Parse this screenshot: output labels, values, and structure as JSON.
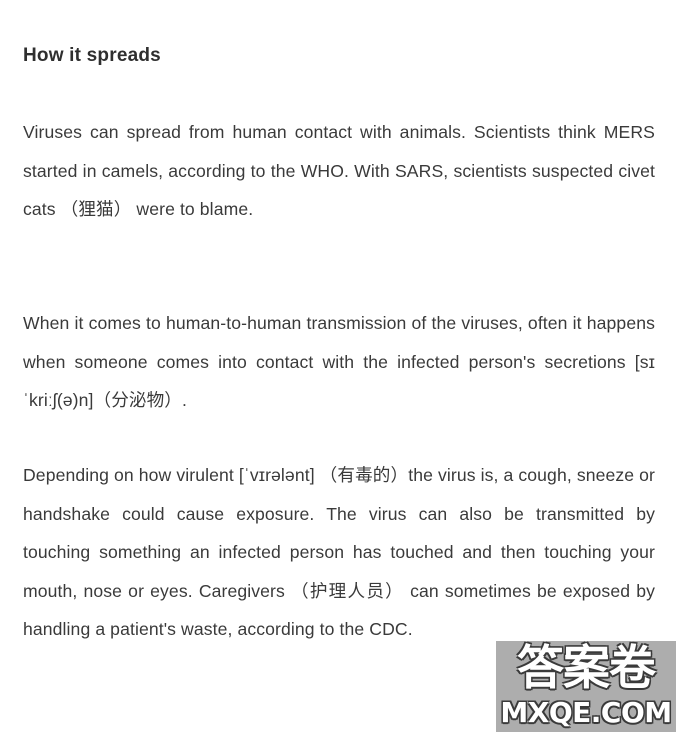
{
  "document": {
    "heading": "How it spreads",
    "paragraphs": [
      "Viruses can spread from human contact with animals. Scientists think MERS started in camels, according to the WHO. With SARS, scientists suspected civet cats （狸猫） were to blame.",
      "When it comes to human-to-human transmission of the viruses, often it happens when someone comes into contact with the infected person's secretions [sɪˈkriːʃ(ə)n]（分泌物）.",
      "Depending on how virulent [ˈvɪrələnt] （有毒的）the virus is, a cough, sneeze or handshake could cause exposure. The virus can also be transmitted by touching something an infected person has touched and then touching your mouth, nose or eyes. Caregivers （护理人员） can sometimes be exposed by handling a patient's waste, according to the CDC."
    ],
    "glossary": [
      {
        "term": "civet cats",
        "ipa": "",
        "chinese": "狸猫"
      },
      {
        "term": "secretions",
        "ipa": "[sɪˈkriːʃ(ə)n]",
        "chinese": "分泌物"
      },
      {
        "term": "virulent",
        "ipa": "[ˈvɪrələnt]",
        "chinese": "有毒的"
      },
      {
        "term": "Caregivers",
        "ipa": "",
        "chinese": "护理人员"
      }
    ],
    "organizations": [
      "WHO",
      "CDC",
      "MERS",
      "SARS"
    ],
    "colors": {
      "background": "#ffffff",
      "heading_text": "#2f2f2f",
      "body_text": "#3a3a3a",
      "watermark_panel": "#adadad",
      "watermark_text": "#ffffff",
      "watermark_outline": "#3a3a3a"
    }
  },
  "watermark": {
    "chinese_label": "答案卷",
    "domain_label": "MXQE.COM"
  }
}
